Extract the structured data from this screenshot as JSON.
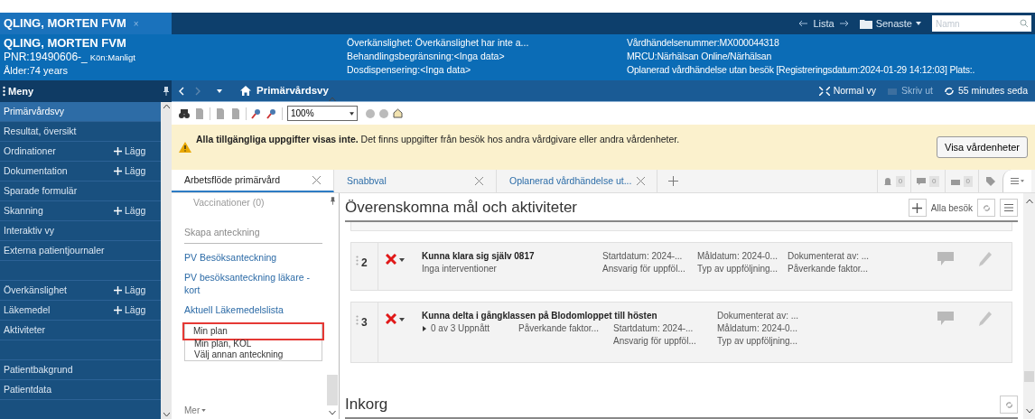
{
  "title_bar": {
    "patient_tab": "QLING, MORTEN FVM",
    "close": "×",
    "list_label": "Lista",
    "recent_label": "Senaste",
    "search": {
      "placeholder": "Namn"
    }
  },
  "patient": {
    "name": "QLING, MORTEN FVM",
    "pnr": "PNR:19490606-_",
    "gender": "Kön:Manligt",
    "age": "Ålder:74 years"
  },
  "info_middle": [
    "Överkänslighet: Överkänslighet har inte a...",
    "Behandlingsbegränsning:<Inga data>",
    "Dosdispensering:<Inga data>"
  ],
  "info_right": [
    "Vårdhändelsenummer:MX000044318",
    "MRCU:Närhälsan Online/Närhälsan",
    "Oplanerad vårdhändelse utan besök [Registreringsdatum:2024-01-29 14:12:03] Plats:."
  ],
  "menu_title": "Meny",
  "nav": {
    "title": "Primärvårdsvy",
    "actions": [
      {
        "label": "Normal vy",
        "disabled": false
      },
      {
        "label": "Skriv ut",
        "disabled": true
      },
      {
        "label": "55 minutes seda",
        "disabled": false
      }
    ]
  },
  "sidebar": {
    "items": [
      {
        "kind": "item",
        "label": "Primärvårdsvy",
        "selected": true
      },
      {
        "kind": "item",
        "label": "Resultat, översikt",
        "selected": false
      },
      {
        "kind": "item",
        "label": "Ordinationer",
        "add": "Lägg",
        "selected": false
      },
      {
        "kind": "item",
        "label": "Dokumentation",
        "add": "Lägg",
        "selected": false
      },
      {
        "kind": "item",
        "label": "Sparade formulär",
        "selected": false
      },
      {
        "kind": "item",
        "label": "Skanning",
        "add": "Lägg",
        "selected": false
      },
      {
        "kind": "item",
        "label": "Interaktiv vy",
        "selected": false
      },
      {
        "kind": "item",
        "label": "Externa patientjournaler",
        "selected": false
      },
      {
        "kind": "spacer"
      },
      {
        "kind": "item",
        "label": "Överkänslighet",
        "add": "Lägg",
        "selected": false
      },
      {
        "kind": "item",
        "label": "Läkemedel",
        "add": "Lägg",
        "selected": false
      },
      {
        "kind": "item",
        "label": "Aktiviteter",
        "selected": false
      },
      {
        "kind": "spacer"
      },
      {
        "kind": "item",
        "label": "Patientbakgrund",
        "selected": false
      },
      {
        "kind": "item",
        "label": "Patientdata",
        "selected": false
      }
    ]
  },
  "toolbar": {
    "zoom": "100%"
  },
  "banner": {
    "text": "**Alla tillgängliga uppgifter visas inte.** Det finns uppgifter från besök hos andra vårdgivare eller andra vårdenheter.",
    "button": "Visa vårdenheter"
  },
  "tabs": [
    {
      "label": "Arbetsflöde primärvård",
      "selected": true
    },
    {
      "label": "Snabbval",
      "selected": false
    },
    {
      "label": "Oplanerad vårdhändelse ut...",
      "selected": false
    }
  ],
  "counters": [
    {
      "kind": "bell",
      "count": "0"
    },
    {
      "kind": "comment",
      "count": "0"
    },
    {
      "kind": "inbox",
      "count": "0"
    }
  ],
  "left_panel": {
    "faded": "Vaccinationer (0)",
    "section": "Skapa anteckning",
    "links": [
      "PV Besöksanteckning",
      "PV besöksanteckning läkare - kort",
      "Aktuell Läkemedelslista"
    ],
    "options": [
      {
        "label": "Min plan",
        "highlighted": true
      },
      {
        "label": "Min plan, KOL",
        "highlighted": false
      },
      {
        "label": "Välj annan anteckning",
        "highlighted": false
      }
    ],
    "more": "Mer"
  },
  "goals": {
    "title": "Överenskomna mål och aktiviteter",
    "filter": "Alla besök",
    "cards": [
      {
        "kind": "compact",
        "number": "2",
        "title": "Kunna klara sig själv 0817",
        "subtitle": "Inga interventioner",
        "columns": [
          [
            "Startdatum: 2024-...",
            "Ansvarig för uppföl..."
          ],
          [
            "Måldatum: 2024-0...",
            "Typ av uppföljning..."
          ],
          [
            "Dokumenterat av: ...",
            "Påverkande faktor..."
          ]
        ]
      },
      {
        "kind": "wide_title",
        "number": "3",
        "title": "Kunna delta i gångklassen på Blodomloppet till hösten",
        "subtitle": "0 av 3 Uppnått",
        "columns": [
          [
            "Påverkande faktor..."
          ],
          [
            "Startdatum: 2024-...",
            "Ansvarig för uppföl..."
          ],
          [
            "Dokumenterat av: ...",
            "Måldatum: 2024-0...",
            "Typ av uppföljning..."
          ]
        ]
      }
    ]
  },
  "inbox": {
    "title": "Inkorg"
  }
}
